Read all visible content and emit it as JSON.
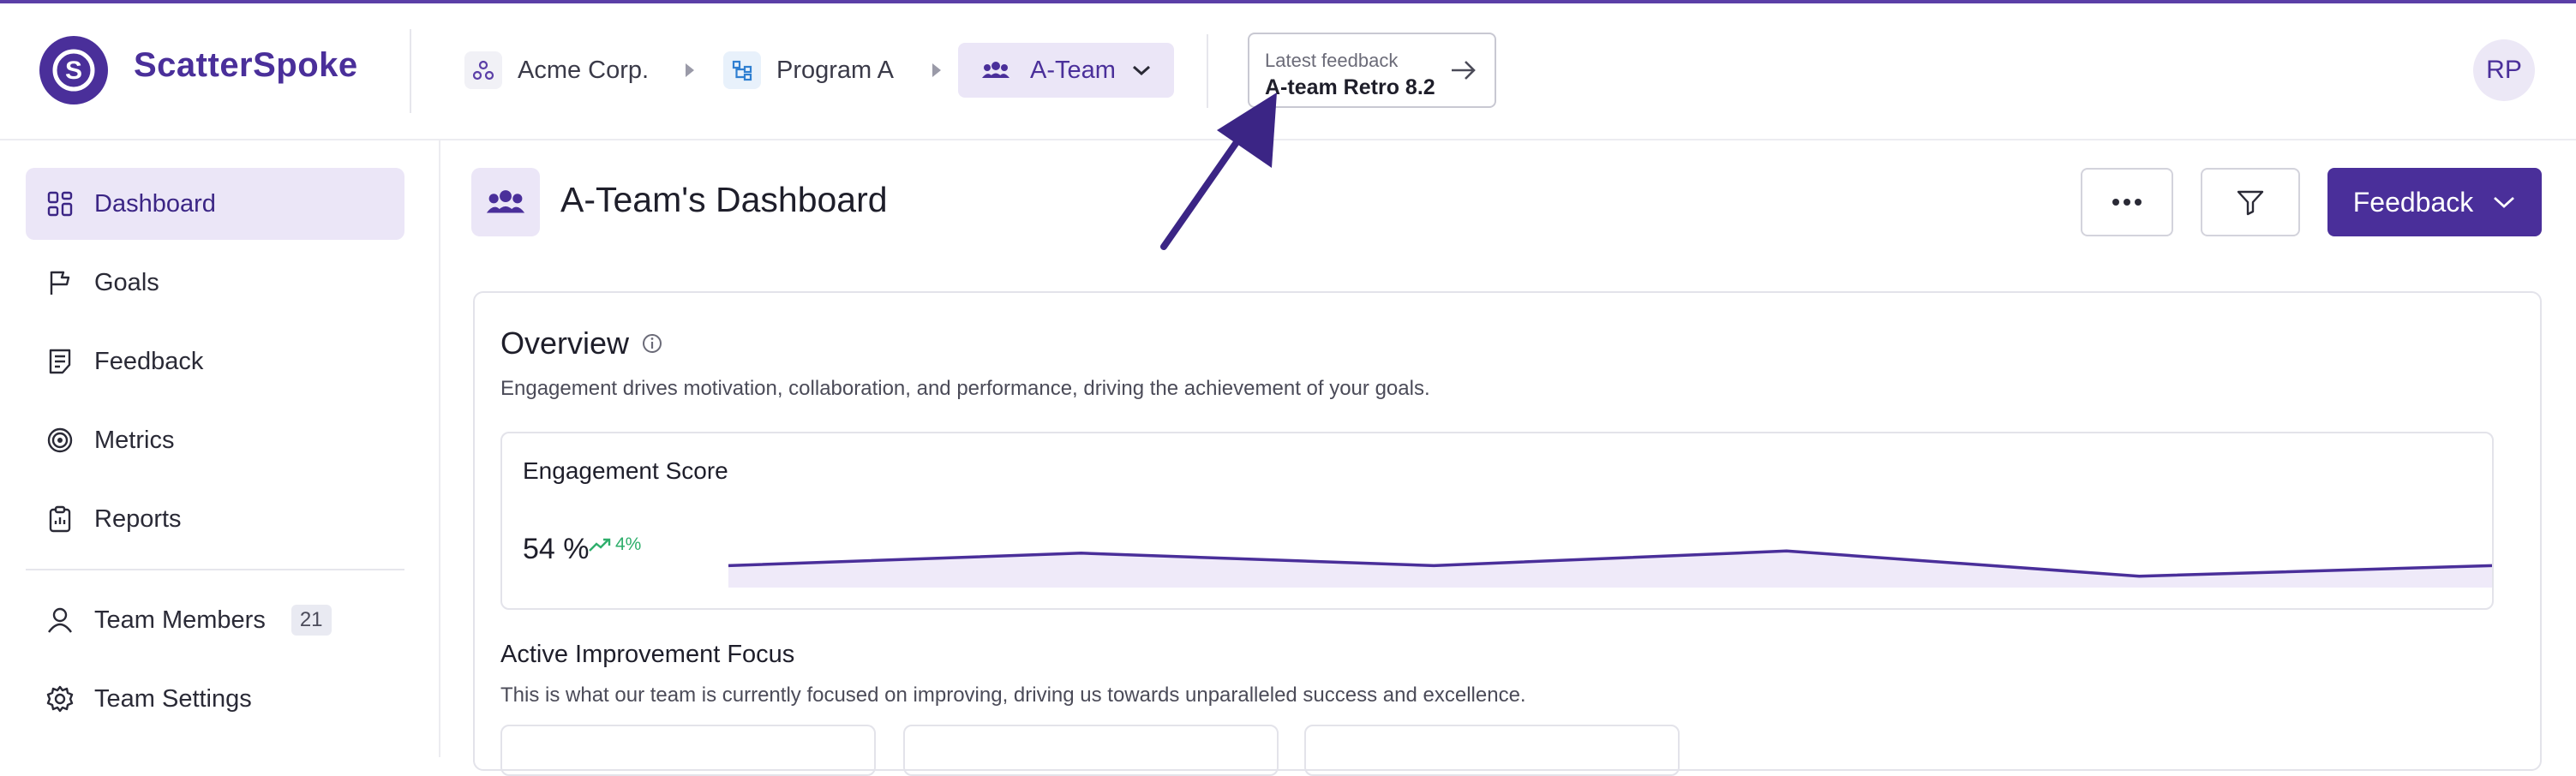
{
  "app": {
    "name": "ScatterSpoke",
    "logo_letter": "S"
  },
  "breadcrumb": [
    {
      "label": "Acme Corp.",
      "icon": "org-icon"
    },
    {
      "label": "Program A",
      "icon": "hierarchy-icon"
    },
    {
      "label": "A-Team",
      "icon": "team-icon",
      "active": true
    }
  ],
  "latest_feedback": {
    "caption": "Latest feedback",
    "title": "A-team Retro 8.2"
  },
  "user": {
    "initials": "RP"
  },
  "sidebar": {
    "items": [
      {
        "label": "Dashboard",
        "icon": "grid-icon",
        "active": true
      },
      {
        "label": "Goals",
        "icon": "flag-icon"
      },
      {
        "label": "Feedback",
        "icon": "document-icon"
      },
      {
        "label": "Metrics",
        "icon": "target-icon"
      },
      {
        "label": "Reports",
        "icon": "clipboard-icon"
      }
    ],
    "team_members": {
      "label": "Team Members",
      "count": "21"
    },
    "team_settings": {
      "label": "Team Settings"
    }
  },
  "page": {
    "title": "A-Team's Dashboard",
    "primary_button": "Feedback"
  },
  "overview": {
    "title": "Overview",
    "description": "Engagement drives motivation, collaboration, and performance, driving the achievement of your goals."
  },
  "engagement": {
    "title": "Engagement Score",
    "value": "54 %",
    "trend": "4%",
    "sparkline": [
      44,
      50,
      44,
      51,
      39,
      44
    ]
  },
  "focus": {
    "title": "Active Improvement Focus",
    "description": "This is what our team is currently focused on improving, driving us towards unparalleled success and excellence."
  },
  "colors": {
    "brand": "#4a2f9a",
    "accent_bg": "#ebe6f7",
    "trend_up": "#2eae6b"
  }
}
